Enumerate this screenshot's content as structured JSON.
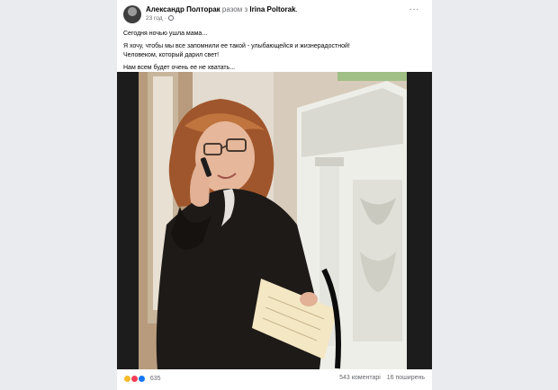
{
  "post": {
    "author": "Александр Полторак",
    "with_word": "разом з",
    "tagged": "Irina Poltorak",
    "tagged_suffix": ".",
    "time": "23 год",
    "time_sep": "·",
    "more": "···",
    "lines": [
      "Сегодня ночью ушла мама...",
      "Я хочу, чтобы мы все запомнили ее такой - улыбающейся и жизнерадостной!",
      "Человеком, который дарил свет!",
      "Нам всем будет очень ее не хватать..."
    ]
  },
  "footer": {
    "reactions_count": "635",
    "comments": "543 коментарі",
    "shares": "16 поширень"
  },
  "icons": [
    "avatar",
    "globe-icon",
    "more-icon",
    "haha-icon",
    "love-icon",
    "like-icon"
  ],
  "colors": {
    "page_bg": "#e9ebee",
    "card_bg": "#ffffff",
    "muted_text": "#65676b",
    "like_blue": "#1877f2"
  }
}
